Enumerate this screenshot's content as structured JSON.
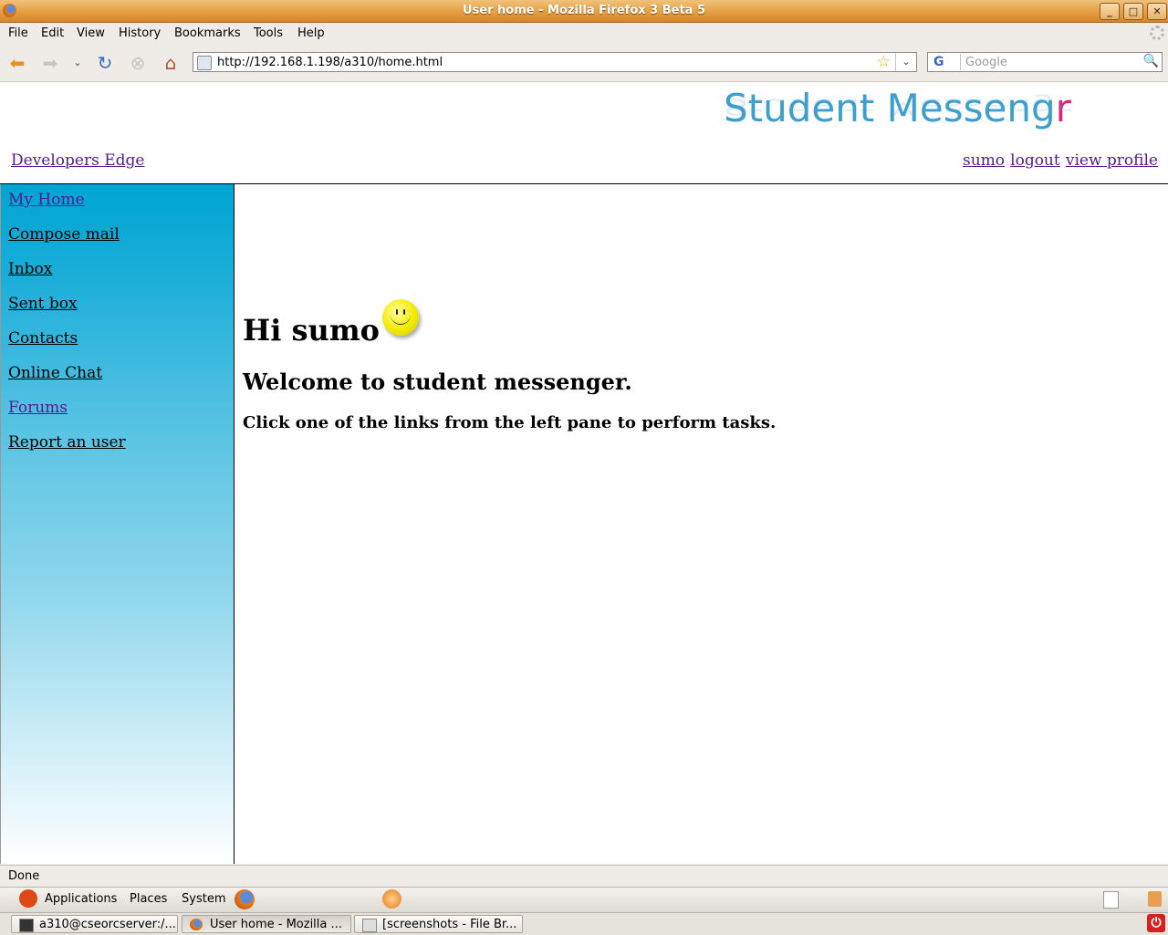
{
  "window": {
    "title": "User home - Mozilla Firefox 3 Beta 5",
    "controls": [
      "minimize",
      "maximize",
      "close"
    ]
  },
  "menubar": {
    "items": [
      {
        "label": "File",
        "accel": "F"
      },
      {
        "label": "Edit",
        "accel": "E"
      },
      {
        "label": "View",
        "accel": "V"
      },
      {
        "label": "History",
        "accel": "s"
      },
      {
        "label": "Bookmarks",
        "accel": "B"
      },
      {
        "label": "Tools",
        "accel": "T"
      },
      {
        "label": "Help",
        "accel": "H"
      }
    ]
  },
  "navbar": {
    "url": "http://192.168.1.198/a310/home.html",
    "search_placeholder": "Google",
    "search_engine": "G"
  },
  "page": {
    "logo_text": "Student Messeng",
    "logo_r": "r",
    "top_left_link": "Developers Edge",
    "top_right_links": [
      "sumo",
      "logout",
      "view profile"
    ],
    "sidebar": [
      {
        "label": "My Home",
        "visited": true
      },
      {
        "label": "Compose mail",
        "visited": false
      },
      {
        "label": "Inbox",
        "visited": false
      },
      {
        "label": "Sent box",
        "visited": false
      },
      {
        "label": "Contacts",
        "visited": false
      },
      {
        "label": "Online Chat",
        "visited": false
      },
      {
        "label": "Forums",
        "visited": true
      },
      {
        "label": "Report an user",
        "visited": false
      }
    ],
    "greeting": "Hi sumo",
    "welcome": "Welcome to student messenger.",
    "instruction": "Click one of the links from the left pane to perform tasks."
  },
  "statusbar": {
    "text": "Done"
  },
  "panel": {
    "menus": [
      "Applications",
      "Places",
      "System"
    ]
  },
  "taskbar": {
    "tasks": [
      {
        "label": "a310@cseorcserver:/...",
        "active": false
      },
      {
        "label": "User home - Mozilla ...",
        "active": true
      },
      {
        "label": "[screenshots - File Br...",
        "active": false
      }
    ]
  },
  "colors": {
    "titlebar": "#e39a3d",
    "sidebar_top": "#00a5d2",
    "logo_blue": "#3d9ed0",
    "logo_pink": "#e0217a",
    "visited_link": "#551a8b"
  }
}
